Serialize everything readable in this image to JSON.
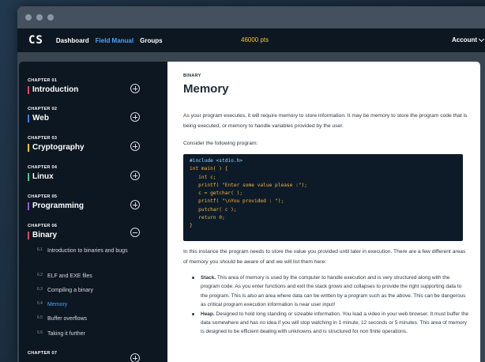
{
  "navbar": {
    "logo": "CS",
    "links": [
      {
        "label": "Dashboard",
        "active": false
      },
      {
        "label": "Field Manual",
        "active": true
      },
      {
        "label": "Groups",
        "active": false
      }
    ],
    "points": "46000 pts",
    "account": "Account"
  },
  "sidebar": {
    "chapters": [
      {
        "number": "CHAPTER 01",
        "title": "Introduction",
        "color": "#e0485a",
        "toggle": "plus-icon"
      },
      {
        "number": "CHAPTER 02",
        "title": "Web",
        "color": "#3d7fe6",
        "toggle": "plus-icon"
      },
      {
        "number": "CHAPTER 03",
        "title": "Cryptography",
        "color": "#f5c236",
        "toggle": "plus-icon"
      },
      {
        "number": "CHAPTER 04",
        "title": "Linux",
        "color": "#37c98b",
        "toggle": "plus-icon"
      },
      {
        "number": "CHAPTER 05",
        "title": "Programming",
        "color": "#8a5cd6",
        "toggle": "plus-icon"
      },
      {
        "number": "CHAPTER 06",
        "title": "Binary",
        "color": "#e0485a",
        "toggle": "minus-icon"
      },
      {
        "number": "CHAPTER 07",
        "title": "",
        "color": "#e0485a",
        "toggle": "plus-icon"
      }
    ],
    "sections": [
      {
        "num": "6.1",
        "label": "Introduction to binaries and bugs",
        "active": false
      },
      {
        "num": "6.2",
        "label": "ELF and EXE files",
        "active": false
      },
      {
        "num": "6.3",
        "label": "Compiling a binary",
        "active": false
      },
      {
        "num": "6.4",
        "label": "Memory",
        "active": true
      },
      {
        "num": "6.5",
        "label": "Buffer overflows",
        "active": false
      },
      {
        "num": "6.6",
        "label": "Taking it further",
        "active": false
      }
    ]
  },
  "content": {
    "kicker": "BINARY",
    "title": "Memory",
    "intro": "As your program executes, it will require memory to store information. It may be memory to store the program code that is being executed, or memory to handle variables provided by the user.",
    "consider": "Consider the following program:",
    "code": [
      "#include <stdio.h>",
      "int main( ) {",
      "   int c;",
      "   printf( \"Enter some value please :\");",
      "   c = getchar( );",
      "   printf( \"\\nYou provided : \");",
      "   putchar( c );",
      "   return 0;",
      "}"
    ],
    "after": "In this instance the program needs to store the value you provided until later in execution. There are a few different areas of memory you should be aware of and we will list them here:",
    "bullets": [
      {
        "term": "Stack.",
        "text": " This area of memory is used by the computer to handle execution and is very structured along with the program code. As you enter functions and exit the stack grows and collapses to provide the right supporting data to the program. This is also an area where data can be written by a program such as the above. This can be dangerous as critical program execution information is near user input!"
      },
      {
        "term": "Heap.",
        "text": " Designed to hold long standing or sizeable information. You load a video in your web browser. It must buffer the data somewhere and has no idea if you will stop watching in 1 minute, 12 seconds or 5 minutes. This area of memory is designed to be efficient dealing with unknowns and is structured for non finite operations."
      }
    ]
  }
}
